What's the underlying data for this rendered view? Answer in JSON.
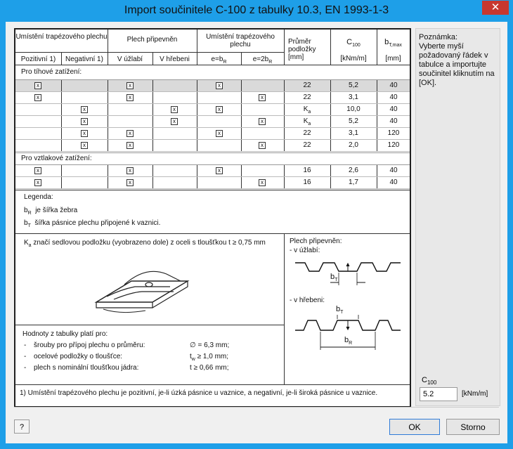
{
  "window": {
    "title": "Import součinitele C-100 z tabulky 10.3, EN 1993-1-3",
    "close_symbol": "✕"
  },
  "table": {
    "headers": {
      "placement": "Umístění trapézového plechu",
      "fastening": "Plech připevněn",
      "placement2": "Umístění trapézového plechu",
      "diameter": "Průměr podložky [mm]",
      "c100": "C",
      "c100_sub": "100",
      "c100_unit": "[kNm/m]",
      "bt": "b",
      "bt_sub": "T,max",
      "bt_unit": "[mm]",
      "positive": "Pozitivní 1)",
      "negative": "Negativní 1)",
      "trough": "V úžlabí",
      "crest": "V hřebeni",
      "e_br": "e=b",
      "e_br_sub": "R",
      "e_2br": "e=2b",
      "e_2br_sub": "R"
    },
    "section_gravity": "Pro tíhové zatížení:",
    "section_uplift": "Pro vztlakové zatížení:",
    "rows": [
      {
        "pos": "x",
        "neg": "",
        "trough": "x",
        "crest": "",
        "ebr": "x",
        "e2br": "",
        "diam": "22",
        "c100": "5,2",
        "bt": "40"
      },
      {
        "pos": "x",
        "neg": "",
        "trough": "x",
        "crest": "",
        "ebr": "",
        "e2br": "x",
        "diam": "22",
        "c100": "3,1",
        "bt": "40"
      },
      {
        "pos": "",
        "neg": "x",
        "trough": "",
        "crest": "x",
        "ebr": "x",
        "e2br": "",
        "diam": "K",
        "diam_sub": "a",
        "c100": "10,0",
        "bt": "40"
      },
      {
        "pos": "",
        "neg": "x",
        "trough": "",
        "crest": "x",
        "ebr": "",
        "e2br": "x",
        "diam": "K",
        "diam_sub": "a",
        "c100": "5,2",
        "bt": "40"
      },
      {
        "pos": "",
        "neg": "x",
        "trough": "x",
        "crest": "",
        "ebr": "x",
        "e2br": "",
        "diam": "22",
        "c100": "3,1",
        "bt": "120"
      },
      {
        "pos": "",
        "neg": "x",
        "trough": "x",
        "crest": "",
        "ebr": "",
        "e2br": "x",
        "diam": "22",
        "c100": "2,0",
        "bt": "120"
      },
      {
        "pos": "x",
        "neg": "",
        "trough": "x",
        "crest": "",
        "ebr": "x",
        "e2br": "",
        "diam": "16",
        "c100": "2,6",
        "bt": "40"
      },
      {
        "pos": "x",
        "neg": "",
        "trough": "x",
        "crest": "",
        "ebr": "",
        "e2br": "x",
        "diam": "16",
        "c100": "1,7",
        "bt": "40"
      }
    ],
    "legend_title": "Legenda:",
    "legend_br": "je šířka žebra",
    "legend_bt": "šířka pásnice plechu připojené k vaznici.",
    "legend_b": "b",
    "legend_r": "R",
    "legend_t": "T",
    "ka_note_k": "K",
    "ka_note_a": "a",
    "ka_note": "značí sedlovou podložku (vyobrazeno dole) z oceli s tloušťkou t ≥ 0,75 mm",
    "fastened_title": "Plech připevněn:",
    "fastened_trough": "-  v úžlabí:",
    "fastened_crest": "-  v hřebeni:",
    "dim_bt": "b",
    "dim_bt_sub": "T",
    "dim_br": "b",
    "dim_br_sub": "R",
    "validity_title": "Hodnoty z tabulky platí pro:",
    "validity_items": [
      {
        "dash": "-",
        "text": "šrouby pro přípoj plechu o průměru:",
        "value": "∅ = 6,3 mm;"
      },
      {
        "dash": "-",
        "text": "ocelové podložky o tloušťce:",
        "value_pre": "t",
        "value_sub": "w",
        "value": " ≥ 1,0 mm;"
      },
      {
        "dash": "-",
        "text": "plech s nominální tloušťkou jádra:",
        "value": "t ≥ 0,66 mm;"
      }
    ],
    "footnote": "1) Umístění trapézového plechu je pozitivní, je-li úzká pásnice u vaznice, a negativní, je-li široká pásnice u vaznice."
  },
  "note": {
    "title": "Poznámka:",
    "text": "Vyberte myší požadovaný řádek v tabulce a importujte součinitel kliknutím na [OK]."
  },
  "c100_field": {
    "label": "C",
    "label_sub": "100",
    "value": "5.2",
    "unit": "[kNm/m]"
  },
  "buttons": {
    "ok": "OK",
    "cancel": "Storno",
    "help": "?"
  },
  "selected_row": 0
}
